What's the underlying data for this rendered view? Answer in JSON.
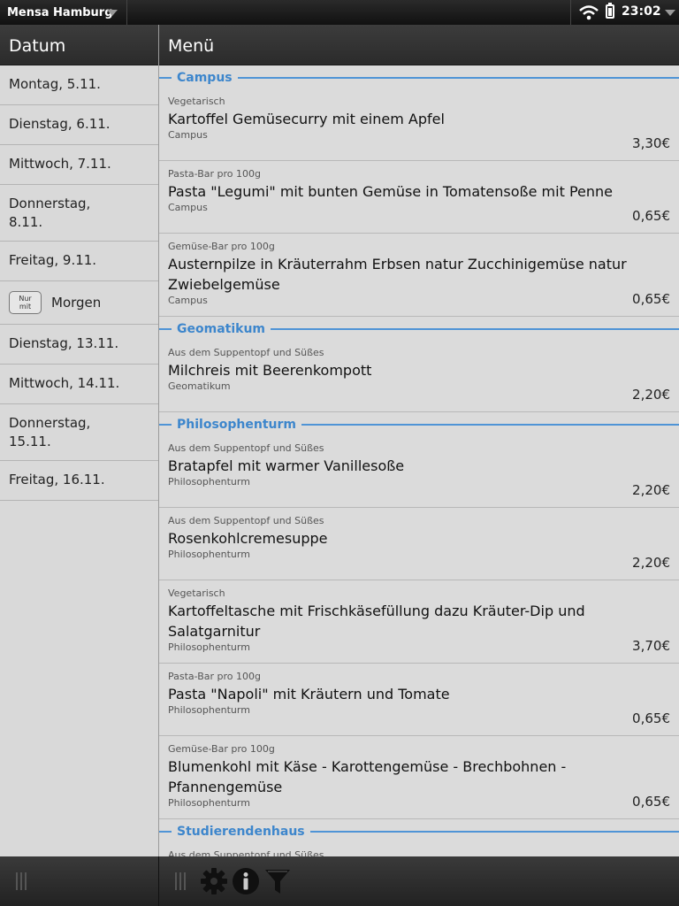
{
  "status_bar": {
    "app_title": "Mensa Hamburg",
    "time": "23:02"
  },
  "sidebar": {
    "header": "Datum",
    "tomorrow_badge": "Nur mit",
    "dates": [
      {
        "label": "Montag, 5.11."
      },
      {
        "label": "Dienstag, 6.11."
      },
      {
        "label": "Mittwoch, 7.11."
      },
      {
        "label": "Donnerstag, 8.11."
      },
      {
        "label": "Freitag, 9.11."
      },
      {
        "label": "Morgen"
      },
      {
        "label": "Dienstag, 13.11."
      },
      {
        "label": "Mittwoch, 14.11."
      },
      {
        "label": "Donnerstag, 15.11."
      },
      {
        "label": "Freitag, 16.11."
      }
    ]
  },
  "main": {
    "header": "Menü",
    "sections": [
      {
        "title": "Campus",
        "meals": [
          {
            "category": "Vegetarisch",
            "name": "Kartoffel Gemüsecurry mit einem Apfel",
            "location": "Campus",
            "price": "3,30€"
          },
          {
            "category": "Pasta-Bar pro 100g",
            "name": "Pasta \"Legumi\" mit bunten Gemüse in Tomatensoße mit Penne",
            "location": "Campus",
            "price": "0,65€"
          },
          {
            "category": "Gemüse-Bar pro 100g",
            "name": "Austernpilze in Kräuterrahm Erbsen natur Zucchinigemüse natur Zwiebelgemüse",
            "location": "Campus",
            "price": "0,65€"
          }
        ]
      },
      {
        "title": "Geomatikum",
        "meals": [
          {
            "category": "Aus dem Suppentopf und Süßes",
            "name": "Milchreis mit Beerenkompott",
            "location": "Geomatikum",
            "price": "2,20€"
          }
        ]
      },
      {
        "title": "Philosophenturm",
        "meals": [
          {
            "category": "Aus dem Suppentopf und Süßes",
            "name": "Bratapfel mit warmer Vanillesoße",
            "location": "Philosophenturm",
            "price": "2,20€"
          },
          {
            "category": "Aus dem Suppentopf und Süßes",
            "name": "Rosenkohlcremesuppe",
            "location": "Philosophenturm",
            "price": "2,20€"
          },
          {
            "category": "Vegetarisch",
            "name": "Kartoffeltasche mit Frischkäsefüllung dazu Kräuter-Dip und Salatgarnitur",
            "location": "Philosophenturm",
            "price": "3,70€"
          },
          {
            "category": "Pasta-Bar pro 100g",
            "name": "Pasta \"Napoli\" mit Kräutern und Tomate",
            "location": "Philosophenturm",
            "price": "0,65€"
          },
          {
            "category": "Gemüse-Bar pro 100g",
            "name": "Blumenkohl mit Käse - Karottengemüse - Brechbohnen - Pfannengemüse",
            "location": "Philosophenturm",
            "price": "0,65€"
          }
        ]
      },
      {
        "title": "Studierendenhaus",
        "meals": [
          {
            "category": "Aus dem Suppentopf und Süßes",
            "name": "",
            "location": "",
            "price": ""
          }
        ]
      }
    ]
  },
  "toolbar": {
    "icons": [
      "gear-icon",
      "info-icon",
      "filter-icon"
    ]
  },
  "colors": {
    "accent": "#3d86cc",
    "section_line": "#4f94d6"
  }
}
